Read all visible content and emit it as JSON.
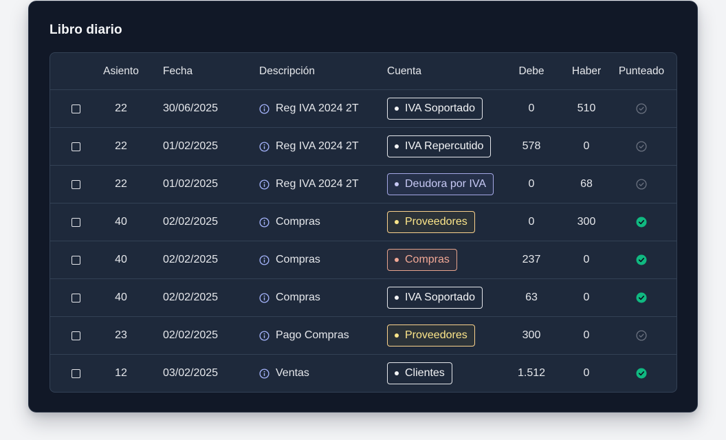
{
  "title": "Libro diario",
  "columns": {
    "asiento": "Asiento",
    "fecha": "Fecha",
    "descripcion": "Descripción",
    "cuenta": "Cuenta",
    "debe": "Debe",
    "haber": "Haber",
    "punteado": "Punteado"
  },
  "tag_styles": {
    "white": {
      "color": "#f3f4f6",
      "border": "#e5e7eb",
      "bg": "transparent"
    },
    "purple": {
      "color": "#c7c9f5",
      "border": "#a5a8e6",
      "bg": "rgba(129,140,248,0.08)"
    },
    "yellow": {
      "color": "#fde68a",
      "border": "#fcd38d",
      "bg": "rgba(250,204,21,0.06)"
    },
    "salmon": {
      "color": "#f2a896",
      "border": "#e8a58e",
      "bg": "rgba(244,114,82,0.07)"
    }
  },
  "status_colors": {
    "checked": "#10b981",
    "unchecked": "#6b7280"
  },
  "rows": [
    {
      "asiento": "22",
      "fecha": "30/06/2025",
      "descripcion": "Reg IVA 2024 2T",
      "cuenta": "IVA Soportado",
      "tag": "white",
      "debe": "0",
      "haber": "510",
      "punteado": false
    },
    {
      "asiento": "22",
      "fecha": "01/02/2025",
      "descripcion": "Reg IVA 2024 2T",
      "cuenta": "IVA Repercutido",
      "tag": "white",
      "debe": "578",
      "haber": "0",
      "punteado": false
    },
    {
      "asiento": "22",
      "fecha": "01/02/2025",
      "descripcion": "Reg IVA 2024 2T",
      "cuenta": "Deudora por IVA",
      "tag": "purple",
      "debe": "0",
      "haber": "68",
      "punteado": false
    },
    {
      "asiento": "40",
      "fecha": "02/02/2025",
      "descripcion": "Compras",
      "cuenta": "Proveedores",
      "tag": "yellow",
      "debe": "0",
      "haber": "300",
      "punteado": true
    },
    {
      "asiento": "40",
      "fecha": "02/02/2025",
      "descripcion": "Compras",
      "cuenta": "Compras",
      "tag": "salmon",
      "debe": "237",
      "haber": "0",
      "punteado": true
    },
    {
      "asiento": "40",
      "fecha": "02/02/2025",
      "descripcion": "Compras",
      "cuenta": "IVA Soportado",
      "tag": "white",
      "debe": "63",
      "haber": "0",
      "punteado": true
    },
    {
      "asiento": "23",
      "fecha": "02/02/2025",
      "descripcion": "Pago Compras",
      "cuenta": "Proveedores",
      "tag": "yellow",
      "debe": "300",
      "haber": "0",
      "punteado": false
    },
    {
      "asiento": "12",
      "fecha": "03/02/2025",
      "descripcion": "Ventas",
      "cuenta": "Clientes",
      "tag": "white",
      "debe": "1.512",
      "haber": "0",
      "punteado": true
    }
  ]
}
